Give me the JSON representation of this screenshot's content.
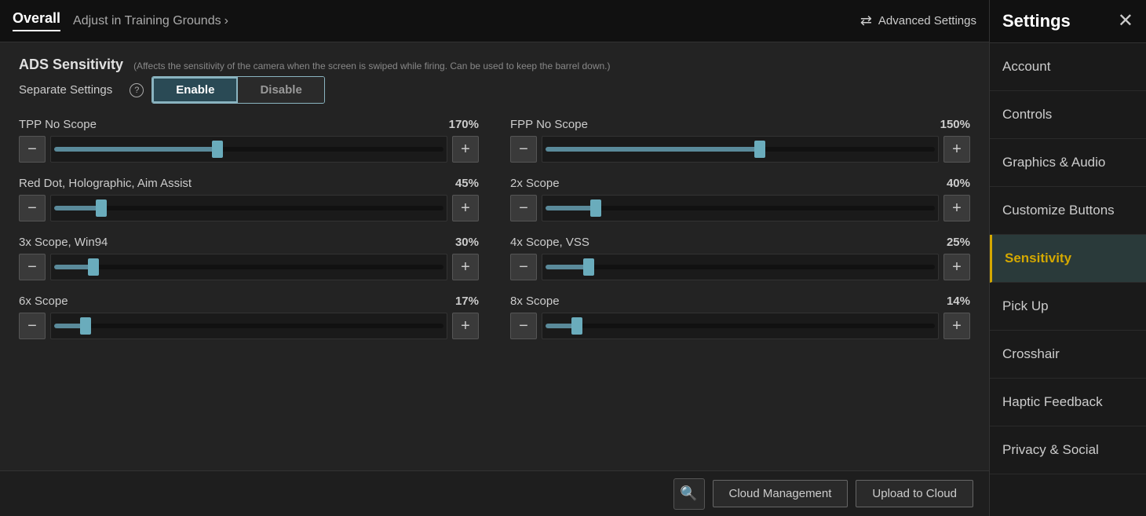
{
  "tabs": {
    "overall": "Overall",
    "training": "Adjust in Training Grounds",
    "arrow": "›"
  },
  "advanced": {
    "icon": "⇄",
    "label": "Advanced Settings"
  },
  "section": {
    "title": "ADS Sensitivity",
    "subtitle": "(Affects the sensitivity of the camera when the screen is swiped while firing. Can be used to keep the barrel down.)"
  },
  "separate_settings": {
    "label": "Separate Settings",
    "question": "?",
    "enable": "Enable",
    "disable": "Disable"
  },
  "sliders": [
    {
      "label": "TPP No Scope",
      "value": "170%",
      "fill_pct": 42,
      "thumb_pct": 42,
      "col": 0
    },
    {
      "label": "FPP No Scope",
      "value": "150%",
      "fill_pct": 55,
      "thumb_pct": 55,
      "col": 1
    },
    {
      "label": "Red Dot, Holographic, Aim Assist",
      "value": "45%",
      "fill_pct": 12,
      "thumb_pct": 12,
      "col": 0
    },
    {
      "label": "2x Scope",
      "value": "40%",
      "fill_pct": 13,
      "thumb_pct": 13,
      "col": 1
    },
    {
      "label": "3x Scope, Win94",
      "value": "30%",
      "fill_pct": 10,
      "thumb_pct": 10,
      "col": 0
    },
    {
      "label": "4x Scope, VSS",
      "value": "25%",
      "fill_pct": 11,
      "thumb_pct": 11,
      "col": 1
    },
    {
      "label": "6x Scope",
      "value": "17%",
      "fill_pct": 8,
      "thumb_pct": 8,
      "col": 0
    },
    {
      "label": "8x Scope",
      "value": "14%",
      "fill_pct": 8,
      "thumb_pct": 8,
      "col": 1
    }
  ],
  "bottom": {
    "search_icon": "🔍",
    "cloud_management": "Cloud Management",
    "upload_to_cloud": "Upload to Cloud"
  },
  "sidebar": {
    "title": "Settings",
    "close": "✕",
    "items": [
      {
        "label": "Account",
        "active": false
      },
      {
        "label": "Controls",
        "active": false
      },
      {
        "label": "Graphics & Audio",
        "active": false
      },
      {
        "label": "Customize Buttons",
        "active": false
      },
      {
        "label": "Sensitivity",
        "active": true
      },
      {
        "label": "Pick Up",
        "active": false
      },
      {
        "label": "Crosshair",
        "active": false
      },
      {
        "label": "Haptic Feedback",
        "active": false
      },
      {
        "label": "Privacy & Social",
        "active": false
      }
    ]
  }
}
